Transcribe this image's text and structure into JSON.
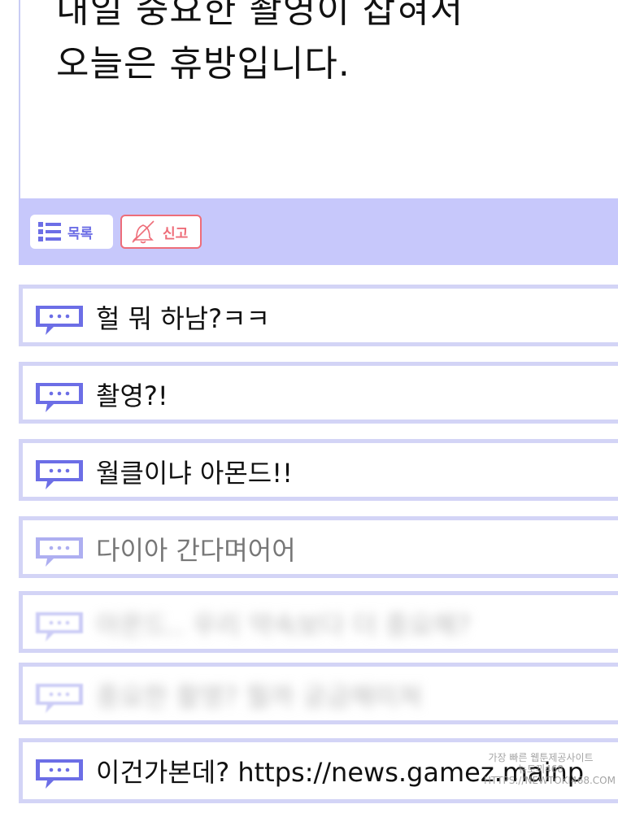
{
  "post": {
    "line1": "내일 중요한 촬영이 잡혀서",
    "line2": "오늘은 휴방입니다."
  },
  "toolbar": {
    "list_label": "목록",
    "report_label": "신고"
  },
  "comments": [
    {
      "text": "헐 뭐 하남?ㅋㅋ"
    },
    {
      "text": "촬영?!"
    },
    {
      "text": "월클이냐 아몬드!!"
    },
    {
      "text": "다이아 간다며어어"
    },
    {
      "text": "아몬드.. 우리 약속보다 더 중요해?"
    },
    {
      "text": "중요한 촬영? 뭘까 궁금해미쳐"
    },
    {
      "text": "이건가본데? https://news.gamez.mainp"
    }
  ],
  "watermark": {
    "line1": "가장 빠른 웹툰제공사이트",
    "line2": "뉴토끼468",
    "line3": "HTTPS://NEWTOKI468.COM"
  },
  "colors": {
    "toolbar_bg": "#c7c8fb",
    "accent": "#6c6ee6",
    "report": "#ee6d79",
    "comment_border": "#d3d4f6"
  }
}
